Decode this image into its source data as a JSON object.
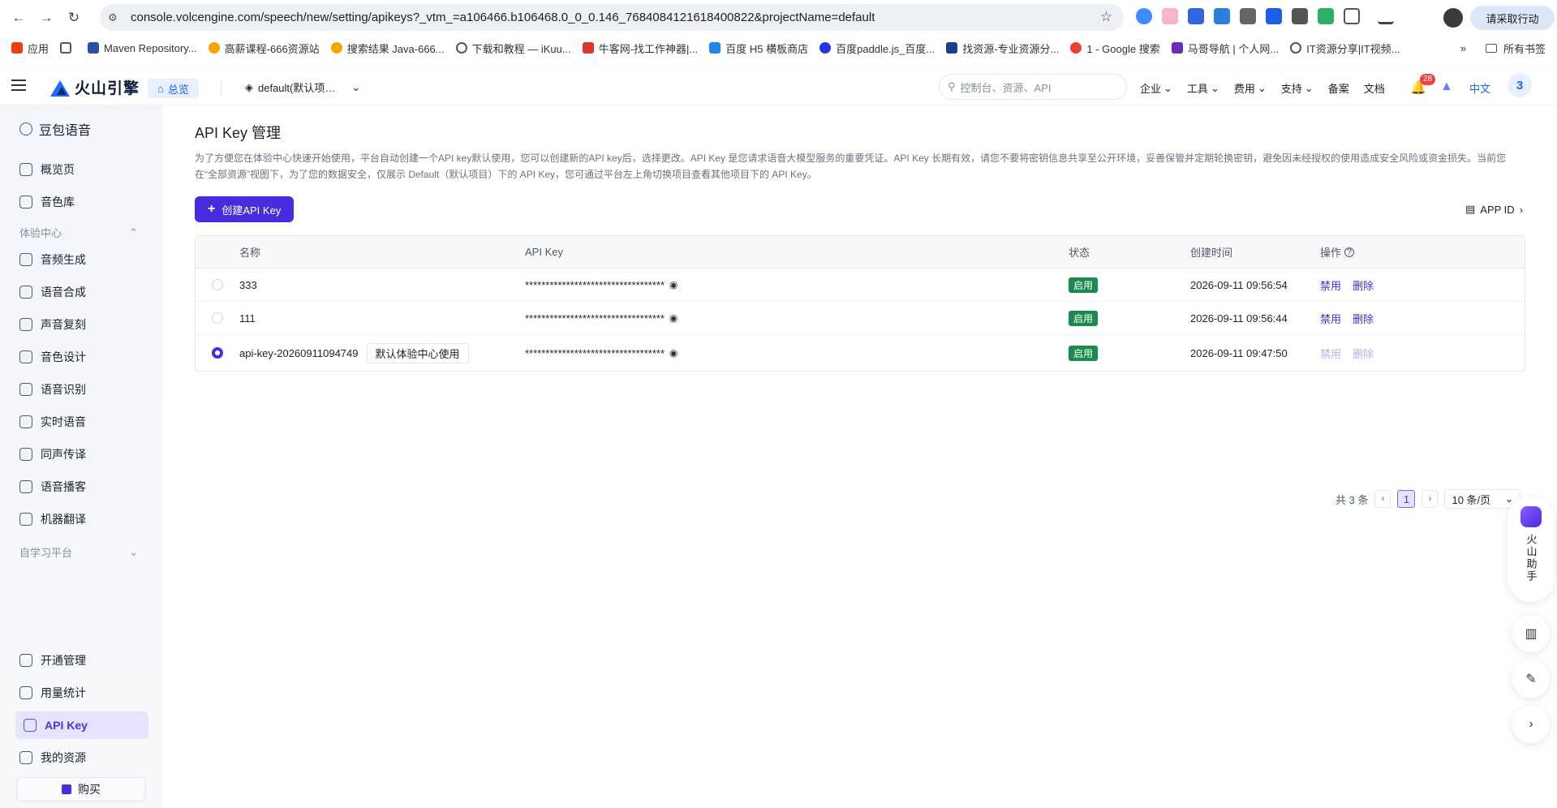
{
  "browser": {
    "url": "console.volcengine.com/speech/new/setting/apikeys?_vtm_=a106466.b106468.0_0_0.146_7684084121618400822&projectName=default",
    "action_label": "请采取行动"
  },
  "bookmarks": {
    "items": [
      {
        "label": "应用"
      },
      {
        "label": "Maven Repository..."
      },
      {
        "label": "高薪课程-666资源站"
      },
      {
        "label": "搜索结果 Java-666..."
      },
      {
        "label": "下载和教程 — iKuu..."
      },
      {
        "label": "牛客网-找工作神器|..."
      },
      {
        "label": "百度 H5 横板商店"
      },
      {
        "label": "百度paddle.js_百度..."
      },
      {
        "label": "找资源-专业资源分..."
      },
      {
        "label": "1 - Google 搜索"
      },
      {
        "label": "马哥导航 | 个人网..."
      },
      {
        "label": "IT资源分享|IT视频..."
      }
    ],
    "all_bookmarks": "所有书签"
  },
  "header": {
    "brand": "火山引擎",
    "overview": "总览",
    "project": "default(默认项…",
    "search_placeholder": "控制台、资源、API",
    "nav": [
      "企业",
      "工具",
      "费用",
      "支持",
      "备案",
      "文档"
    ],
    "notif_count": "28",
    "lang": "中文",
    "avatar": "3"
  },
  "sidebar": {
    "title": "豆包语音",
    "top_items": [
      {
        "label": "概览页"
      },
      {
        "label": "音色库"
      }
    ],
    "group_experience": "体验中心",
    "experience_items": [
      {
        "label": "音频生成"
      },
      {
        "label": "语音合成"
      },
      {
        "label": "声音复刻"
      },
      {
        "label": "音色设计"
      },
      {
        "label": "语音识别"
      },
      {
        "label": "实时语音"
      },
      {
        "label": "同声传译"
      },
      {
        "label": "语音播客"
      },
      {
        "label": "机器翻译"
      }
    ],
    "group_self_learning": "自学习平台",
    "bottom_items": [
      {
        "label": "开通管理"
      },
      {
        "label": "用量统计"
      },
      {
        "label": "API Key"
      },
      {
        "label": "我的资源"
      }
    ],
    "buy": "购买"
  },
  "main": {
    "title": "API Key 管理",
    "desc": "为了方便您在体验中心快速开始使用，平台自动创建一个API key默认使用，您可以创建新的API key后，选择更改。API Key 是您请求语音大模型服务的重要凭证。API Key 长期有效，请您不要将密钥信息共享至公开环境，妥善保管并定期轮换密钥，避免因未经授权的使用造成安全风险或资金损失。当前您在“全部资源”视图下，为了您的数据安全，仅展示 Default（默认项目）下的 API Key，您可通过平台左上角切换项目查看其他项目下的 API Key。",
    "create_btn": "创建API Key",
    "app_id": "APP ID",
    "table": {
      "headers": [
        "名称",
        "API Key",
        "状态",
        "创建时间",
        "操作"
      ],
      "rows": [
        {
          "name": "333",
          "key": "**********************************",
          "status": "启用",
          "created": "2026-09-11 09:56:54",
          "op1": "禁用",
          "op2": "删除",
          "selected": false,
          "tag": ""
        },
        {
          "name": "111",
          "key": "**********************************",
          "status": "启用",
          "created": "2026-09-11 09:56:44",
          "op1": "禁用",
          "op2": "删除",
          "selected": false,
          "tag": ""
        },
        {
          "name": "api-key-20260911094749",
          "key": "**********************************",
          "status": "启用",
          "created": "2026-09-11 09:47:50",
          "op1": "禁用",
          "op2": "删除",
          "selected": true,
          "tag": "默认体验中心使用"
        }
      ]
    },
    "pager": {
      "total": "共 3 条",
      "current": "1",
      "size": "10 条/页"
    }
  },
  "assistant": {
    "label": "火山助手"
  },
  "colors": {
    "accent": "#4b2bde",
    "brand_blue": "#1664ff",
    "status_green": "#1b8a4e"
  }
}
